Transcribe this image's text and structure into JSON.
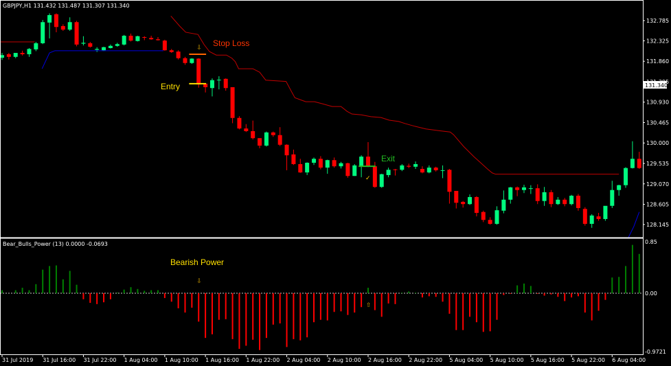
{
  "window": {
    "header": "GBPJPY,H1  131.432 131.487 131.307 131.340",
    "current_price_label": "131.340"
  },
  "indicator": {
    "header": "Bear_Bulls_Power (13)  0.0000 -0.0693"
  },
  "annotations": {
    "stop_loss": "Stop Loss",
    "entry": "Entry",
    "exit": "Exit",
    "bearish_power": "Bearish Power"
  },
  "colors": {
    "background": "#000000",
    "bull": "#00FA7F",
    "bear": "#FF0000",
    "stop_line": "#C00000",
    "blue_line": "#0000E0",
    "hist_pos": "#008000",
    "hist_neg": "#FF0000",
    "stop_loss_text": "#FF3300",
    "entry_text": "#FFE000",
    "exit_text": "#22BB22",
    "arrow": "#D4A000",
    "axis": "#FFFFFF"
  },
  "chart_data": [
    {
      "type": "candlestick",
      "symbol": "GBPJPY",
      "timeframe": "H1",
      "ylim": [
        128.0,
        133.1
      ],
      "y_ticks": [
        "132.785",
        "132.325",
        "131.860",
        "131.395",
        "130.930",
        "130.465",
        "130.000",
        "129.535",
        "129.070",
        "128.605",
        "128.145"
      ],
      "x_ticks": [
        "31 Jul 2019",
        "31 Jul 16:00",
        "31 Jul 22:00",
        "1 Aug 04:00",
        "1 Aug 10:00",
        "1 Aug 16:00",
        "1 Aug 22:00",
        "2 Aug 04:00",
        "2 Aug 10:00",
        "2 Aug 16:00",
        "2 Aug 22:00",
        "5 Aug 04:00",
        "5 Aug 10:00",
        "5 Aug 16:00",
        "5 Aug 22:00",
        "6 Aug 04:00"
      ],
      "ohlc": [
        [
          131.94,
          132.05,
          131.89,
          132.0
        ],
        [
          132.02,
          132.05,
          131.9,
          131.96
        ],
        [
          131.96,
          132.02,
          131.93,
          132.05
        ],
        [
          132.05,
          132.1,
          131.99,
          132.02
        ],
        [
          132.02,
          132.16,
          131.96,
          132.14
        ],
        [
          132.13,
          132.3,
          132.09,
          132.27
        ],
        [
          132.27,
          132.8,
          132.25,
          132.75
        ],
        [
          132.74,
          132.95,
          132.38,
          132.91
        ],
        [
          132.93,
          132.95,
          132.52,
          132.64
        ],
        [
          132.66,
          132.7,
          132.55,
          132.58
        ],
        [
          132.58,
          132.86,
          132.55,
          132.75
        ],
        [
          132.75,
          132.78,
          132.2,
          132.24
        ],
        [
          132.26,
          132.43,
          132.22,
          132.28
        ],
        [
          132.27,
          132.3,
          132.17,
          132.19
        ],
        [
          132.12,
          132.18,
          132.07,
          132.14
        ],
        [
          132.11,
          132.19,
          132.09,
          132.18
        ],
        [
          132.16,
          132.24,
          132.15,
          132.21
        ],
        [
          132.21,
          132.28,
          132.19,
          132.25
        ],
        [
          132.24,
          132.46,
          132.22,
          132.44
        ],
        [
          132.44,
          132.49,
          132.31,
          132.33
        ],
        [
          132.32,
          132.44,
          132.31,
          132.43
        ],
        [
          132.41,
          132.43,
          132.34,
          132.4
        ],
        [
          132.39,
          132.44,
          132.35,
          132.36
        ],
        [
          132.36,
          132.41,
          132.33,
          132.34
        ],
        [
          132.33,
          132.35,
          132.1,
          132.11
        ],
        [
          132.11,
          132.14,
          132.05,
          132.07
        ],
        [
          132.08,
          132.11,
          131.9,
          131.93
        ],
        [
          131.93,
          131.96,
          131.78,
          131.82
        ],
        [
          131.82,
          131.93,
          131.8,
          131.92
        ],
        [
          131.92,
          131.93,
          131.26,
          131.33
        ],
        [
          131.35,
          131.36,
          131.15,
          131.27
        ],
        [
          131.25,
          131.47,
          131.06,
          131.43
        ],
        [
          131.43,
          131.52,
          131.22,
          131.44
        ],
        [
          131.46,
          131.47,
          131.19,
          131.25
        ],
        [
          131.27,
          131.27,
          130.45,
          130.57
        ],
        [
          130.57,
          130.61,
          130.31,
          130.33
        ],
        [
          130.33,
          130.43,
          130.25,
          130.27
        ],
        [
          130.27,
          130.51,
          130.08,
          130.11
        ],
        [
          130.11,
          130.11,
          129.88,
          129.94
        ],
        [
          129.94,
          130.26,
          129.92,
          130.24
        ],
        [
          130.24,
          130.26,
          130.14,
          130.18
        ],
        [
          130.18,
          130.36,
          129.93,
          129.96
        ],
        [
          129.96,
          129.97,
          129.38,
          129.72
        ],
        [
          129.74,
          129.85,
          129.5,
          129.52
        ],
        [
          129.52,
          129.64,
          129.32,
          129.33
        ],
        [
          129.33,
          129.56,
          129.27,
          129.55
        ],
        [
          129.55,
          129.67,
          129.5,
          129.64
        ],
        [
          129.64,
          129.7,
          129.4,
          129.44
        ],
        [
          129.44,
          129.62,
          129.3,
          129.61
        ],
        [
          129.61,
          129.67,
          129.44,
          129.47
        ],
        [
          129.47,
          129.57,
          129.42,
          129.54
        ],
        [
          129.54,
          129.55,
          129.21,
          129.25
        ],
        [
          129.25,
          129.52,
          129.25,
          129.49
        ],
        [
          129.47,
          129.72,
          129.22,
          129.69
        ],
        [
          129.69,
          130.02,
          129.45,
          129.47
        ],
        [
          129.47,
          129.57,
          128.98,
          129.0
        ],
        [
          129.0,
          129.3,
          128.98,
          129.29
        ],
        [
          129.27,
          129.44,
          129.22,
          129.39
        ],
        [
          129.4,
          129.41,
          129.26,
          129.39
        ],
        [
          129.39,
          129.52,
          129.36,
          129.49
        ],
        [
          129.48,
          129.53,
          129.43,
          129.46
        ],
        [
          129.46,
          129.58,
          129.41,
          129.52
        ],
        [
          129.41,
          129.47,
          129.31,
          129.33
        ],
        [
          129.33,
          129.49,
          129.31,
          129.44
        ],
        [
          129.44,
          129.46,
          129.35,
          129.38
        ],
        [
          129.38,
          129.49,
          129.2,
          129.38
        ],
        [
          129.39,
          129.41,
          128.62,
          128.89
        ],
        [
          128.91,
          128.91,
          128.51,
          128.64
        ],
        [
          128.66,
          128.68,
          128.53,
          128.61
        ],
        [
          128.61,
          128.83,
          128.59,
          128.77
        ],
        [
          128.77,
          128.79,
          128.33,
          128.41
        ],
        [
          128.43,
          128.46,
          128.2,
          128.25
        ],
        [
          128.25,
          128.31,
          128.14,
          128.16
        ],
        [
          128.16,
          128.56,
          128.14,
          128.47
        ],
        [
          128.46,
          128.92,
          128.4,
          128.71
        ],
        [
          128.71,
          129.0,
          128.62,
          128.99
        ],
        [
          128.99,
          129.01,
          128.79,
          128.93
        ],
        [
          128.93,
          129.05,
          128.86,
          128.99
        ],
        [
          128.97,
          129.04,
          128.84,
          128.97
        ],
        [
          128.97,
          129.06,
          128.61,
          128.68
        ],
        [
          128.68,
          129.0,
          128.57,
          128.88
        ],
        [
          128.88,
          128.93,
          128.54,
          128.61
        ],
        [
          128.61,
          128.77,
          128.59,
          128.71
        ],
        [
          128.71,
          128.75,
          128.56,
          128.61
        ],
        [
          128.61,
          128.82,
          128.58,
          128.8
        ],
        [
          128.8,
          128.84,
          128.46,
          128.52
        ],
        [
          128.5,
          128.54,
          128.12,
          128.16
        ],
        [
          128.16,
          128.38,
          128.07,
          128.35
        ],
        [
          128.33,
          128.41,
          128.23,
          128.27
        ],
        [
          128.27,
          128.55,
          128.23,
          128.57
        ],
        [
          128.57,
          129.14,
          128.52,
          128.93
        ],
        [
          128.93,
          129.05,
          128.8,
          129.04
        ],
        [
          129.04,
          129.45,
          128.98,
          129.43
        ],
        [
          129.43,
          130.04,
          129.42,
          129.64
        ],
        [
          129.64,
          129.8,
          129.41,
          129.43
        ]
      ],
      "stop_line": [
        [
          24.9,
          132.89
        ],
        [
          26.2,
          132.66
        ],
        [
          27.1,
          132.52
        ],
        [
          28.9,
          132.47
        ],
        [
          29.8,
          132.24
        ],
        [
          30.6,
          132.08
        ],
        [
          31.6,
          132.0
        ],
        [
          33.1,
          132.0
        ],
        [
          33.9,
          131.93
        ],
        [
          34.4,
          131.85
        ],
        [
          34.9,
          131.69
        ],
        [
          37.0,
          131.69
        ],
        [
          38.0,
          131.61
        ],
        [
          38.9,
          131.43
        ],
        [
          41.9,
          131.4
        ],
        [
          42.8,
          131.14
        ],
        [
          43.2,
          131.03
        ],
        [
          43.9,
          130.99
        ],
        [
          44.8,
          130.94
        ],
        [
          46.1,
          130.94
        ],
        [
          47.3,
          130.89
        ],
        [
          48.7,
          130.83
        ],
        [
          50,
          130.83
        ],
        [
          50.9,
          130.72
        ],
        [
          51.6,
          130.66
        ],
        [
          53,
          130.64
        ],
        [
          54.4,
          130.6
        ],
        [
          55.9,
          130.58
        ],
        [
          57.1,
          130.52
        ],
        [
          58.5,
          130.49
        ],
        [
          59.5,
          130.44
        ],
        [
          60.9,
          130.38
        ],
        [
          62.5,
          130.32
        ],
        [
          64.5,
          130.28
        ],
        [
          66.1,
          130.25
        ],
        [
          66.6,
          130.19
        ],
        [
          68.1,
          129.92
        ],
        [
          69.6,
          129.69
        ],
        [
          70.6,
          129.55
        ],
        [
          71.6,
          129.41
        ],
        [
          72.3,
          129.32
        ],
        [
          72.8,
          129.29
        ],
        [
          91,
          129.29
        ]
      ],
      "stop_line_left": [
        [
          -0.3,
          132.3
        ],
        [
          4.8,
          132.3
        ]
      ],
      "blue_line": [
        [
          5.9,
          131.69
        ],
        [
          7,
          132.05
        ],
        [
          7.8,
          132.1
        ],
        [
          23.8,
          132.1
        ]
      ],
      "blue_line_right": [
        [
          92.4,
          127.85
        ],
        [
          93.2,
          128.1
        ],
        [
          94,
          128.43
        ]
      ],
      "markers": {
        "stop_level": {
          "bars": [
            28,
            30
          ],
          "price": 132.02
        },
        "entry_level": {
          "bars": [
            28,
            30
          ],
          "price": 131.35
        },
        "exit_level": {
          "bars": [
            53,
            55
          ],
          "price": 129.47
        },
        "sell_arrow_bar": 29,
        "exit_check_bar": 54
      }
    },
    {
      "type": "bar",
      "name": "Bear_Bulls_Power (13)",
      "ylim": [
        -0.9721,
        0.85
      ],
      "y_ticks": [
        "0.85",
        "0.00",
        "-0.9721"
      ],
      "values": [
        0.05,
        0.0,
        0.05,
        0.09,
        0.05,
        0.15,
        0.39,
        0.45,
        0.46,
        0.23,
        0.37,
        0.14,
        -0.1,
        -0.16,
        -0.18,
        -0.15,
        -0.1,
        0.01,
        0.06,
        0.1,
        0.07,
        0.04,
        0.05,
        0.05,
        -0.08,
        -0.14,
        -0.25,
        -0.32,
        -0.24,
        -0.47,
        -0.74,
        -0.68,
        -0.44,
        -0.43,
        -0.76,
        -0.92,
        -0.87,
        -0.77,
        -0.94,
        -0.74,
        -0.52,
        -0.5,
        -0.89,
        -0.76,
        -0.78,
        -0.73,
        -0.48,
        -0.44,
        -0.45,
        -0.31,
        -0.3,
        -0.36,
        -0.32,
        -0.23,
        0.09,
        -0.28,
        -0.39,
        -0.17,
        -0.18,
        0.01,
        0.03,
        0.01,
        -0.07,
        -0.05,
        -0.06,
        -0.14,
        -0.34,
        -0.61,
        -0.61,
        -0.39,
        -0.48,
        -0.64,
        -0.63,
        -0.44,
        -0.03,
        -0.01,
        0.13,
        0.16,
        0.12,
        -0.01,
        -0.04,
        -0.02,
        -0.06,
        -0.13,
        -0.07,
        -0.05,
        -0.32,
        -0.45,
        -0.29,
        -0.11,
        0.26,
        0.27,
        0.45,
        0.8,
        0.65
      ],
      "markers": {
        "down_arrow_bar": 29,
        "up_arrow_bar": 54
      }
    }
  ]
}
